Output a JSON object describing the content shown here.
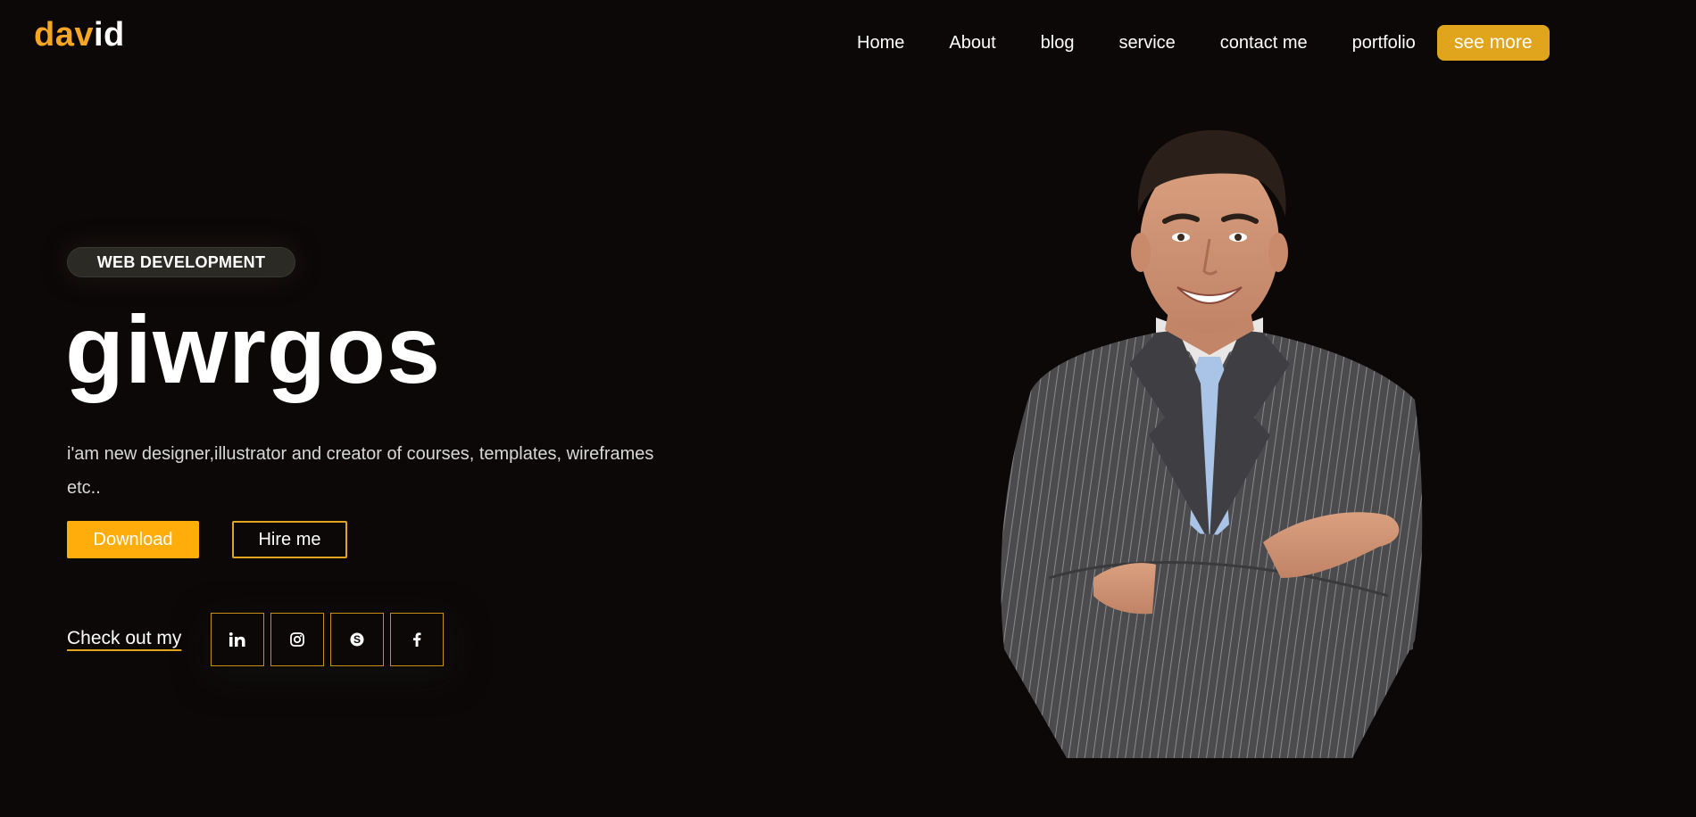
{
  "logo": {
    "part1": "dav",
    "part2": "id"
  },
  "nav": {
    "items": [
      "Home",
      "About",
      "blog",
      "service",
      "contact me",
      "portfolio"
    ],
    "see_more": "see more"
  },
  "hero": {
    "badge": "WEB DEVELOPMENT",
    "title": "giwrgos",
    "description": "i'am new designer,illustrator and creator of courses, templates, wireframes etc..",
    "download_label": "Download",
    "hire_label": "Hire me",
    "checkout_label": "Check out my"
  },
  "socials": [
    "linkedin-icon",
    "instagram-icon",
    "skype-icon",
    "facebook-icon"
  ],
  "colors": {
    "background": "#0c0808",
    "accent": "#ffad0a",
    "accent_dark": "#e0a51c"
  }
}
